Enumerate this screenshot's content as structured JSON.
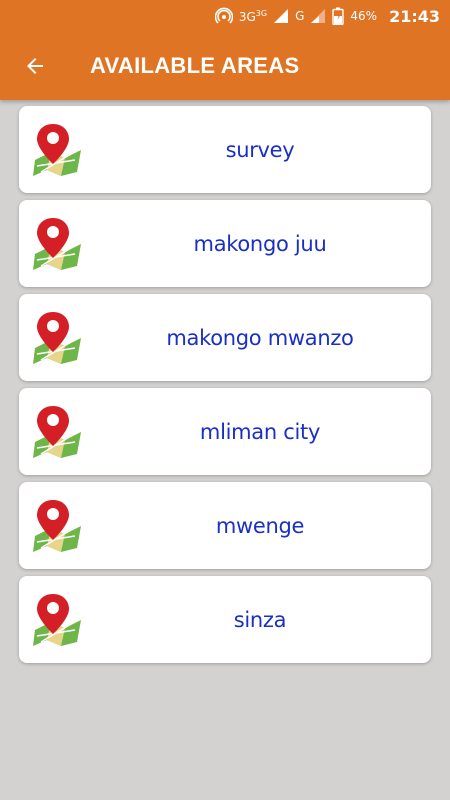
{
  "status_bar": {
    "network_3g": "3G",
    "network_3g_sup": "3G",
    "network_g": "G",
    "battery": "46%",
    "time": "21:43"
  },
  "app_bar": {
    "title": "AVAILABLE AREAS",
    "back_icon": "arrow-left-icon",
    "color": "#e07425"
  },
  "areas": [
    {
      "name": "survey",
      "icon": "map-pin-icon"
    },
    {
      "name": "makongo juu",
      "icon": "map-pin-icon"
    },
    {
      "name": "makongo mwanzo",
      "icon": "map-pin-icon"
    },
    {
      "name": "mliman city",
      "icon": "map-pin-icon"
    },
    {
      "name": "mwenge",
      "icon": "map-pin-icon"
    },
    {
      "name": "sinza",
      "icon": "map-pin-icon"
    }
  ],
  "colors": {
    "label": "#1a2fc6",
    "background": "#d4d2d0",
    "card": "#ffffff"
  }
}
